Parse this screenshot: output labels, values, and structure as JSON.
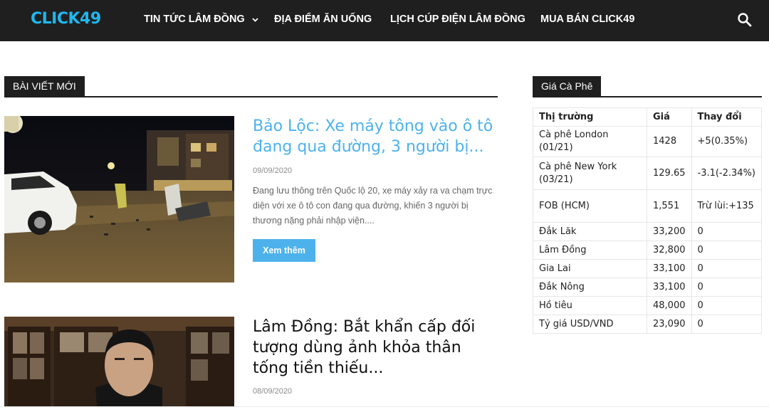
{
  "header": {
    "logo": "CLICK49",
    "nav": [
      {
        "label": "TIN TỨC LÂM ĐỒNG",
        "has_dropdown": true
      },
      {
        "label": "ĐỊA ĐIỂM ĂN UỐNG"
      },
      {
        "label": "LỊCH CÚP ĐIỆN LÂM ĐỒNG"
      },
      {
        "label": "MUA BÁN CLICK49"
      }
    ],
    "search_icon": "search-icon"
  },
  "main": {
    "section_title": "BÀI VIẾT MỚI",
    "articles": [
      {
        "title": "Bảo Lộc: Xe máy tông vào ô tô đang qua đường, 3 người bị...",
        "date": "09/09/2020",
        "excerpt": "Đang lưu thông trên Quốc lộ 20, xe máy xảy ra va chạm trực diện với xe ô tô con đang qua đường, khiến 3 người bị thương nặng phải nhập viện....",
        "button": "Xem thêm"
      },
      {
        "title": "Lâm Đồng: Bắt khẩn cấp đối tượng dùng ảnh khỏa thân tống tiền thiếu...",
        "date": "08/09/2020"
      }
    ]
  },
  "sidebar": {
    "section_title": "Giá Cà Phê",
    "table": {
      "headers": [
        "Thị trường",
        "Giá",
        "Thay đổi"
      ],
      "rows": [
        [
          "Cà phê London (01/21)",
          "1428",
          "+5(0.35%)"
        ],
        [
          "Cà phê New York (03/21)",
          "129.65",
          "-3.1(-2.34%)"
        ],
        [
          "FOB (HCM)",
          "1,551",
          "Trừ lùi:+135"
        ],
        [
          "Đắk Lăk",
          "33,200",
          "0"
        ],
        [
          "Lâm Đồng",
          "32,800",
          "0"
        ],
        [
          "Gia Lai",
          "33,100",
          "0"
        ],
        [
          "Đắk Nông",
          "33,100",
          "0"
        ],
        [
          "Hồ tiêu",
          "48,000",
          "0"
        ],
        [
          "Tỷ giá USD/VND",
          "23,090",
          "0"
        ]
      ]
    }
  },
  "colors": {
    "navbar_bg": "#1f1f1f",
    "logo": "#1fb7ee",
    "accent_blue": "#4db2ec",
    "date_gray": "#8a8a8a"
  }
}
